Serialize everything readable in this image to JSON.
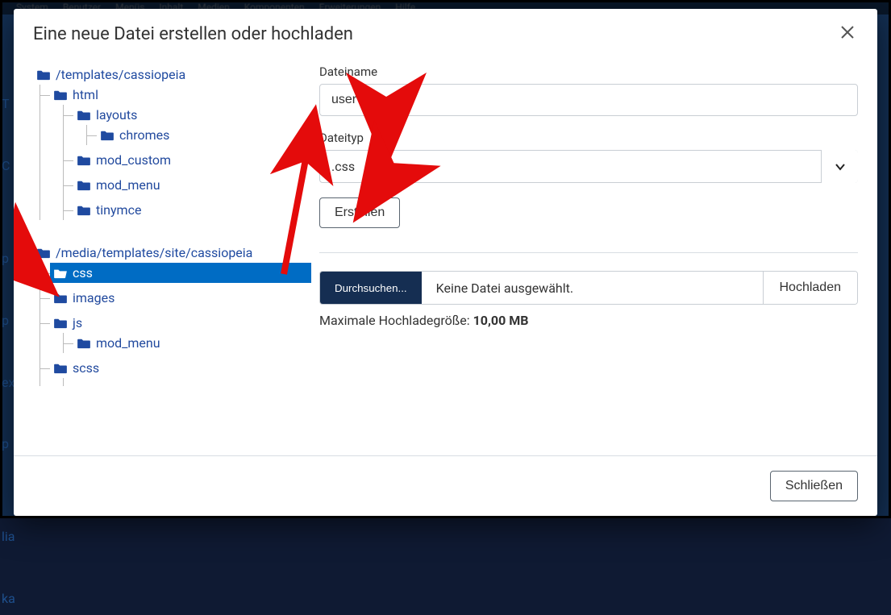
{
  "modal": {
    "title": "Eine neue Datei erstellen oder hochladen",
    "close_btn_name": "close"
  },
  "tree": {
    "root1": {
      "label": "/templates/cassiopeia",
      "children": [
        {
          "key": "html",
          "label": "html",
          "children": [
            {
              "key": "layouts",
              "label": "layouts",
              "children": [
                {
                  "key": "chromes",
                  "label": "chromes"
                }
              ]
            },
            {
              "key": "mod_custom",
              "label": "mod_custom"
            },
            {
              "key": "mod_menu",
              "label": "mod_menu"
            },
            {
              "key": "tinymce",
              "label": "tinymce"
            }
          ]
        }
      ]
    },
    "root2": {
      "label": "/media/templates/site/cassiopeia",
      "children": [
        {
          "key": "css",
          "label": "css",
          "selected": true
        },
        {
          "key": "images",
          "label": "images"
        },
        {
          "key": "js",
          "label": "js",
          "children": [
            {
              "key": "js_mod_menu",
              "label": "mod_menu"
            }
          ]
        },
        {
          "key": "scss",
          "label": "scss",
          "children": [
            {
              "key": "scss_hidden",
              "label": ""
            }
          ]
        }
      ]
    }
  },
  "form": {
    "filename_label": "Dateiname",
    "filename_value": "user",
    "filetype_label": "Dateityp",
    "filetype_value": ".css",
    "create_btn": "Erstellen",
    "browse_btn": "Durchsuchen...",
    "no_file": "Keine Datei ausgewählt.",
    "upload_btn": "Hochladen",
    "max_upload_prefix": "Maximale Hochladegröße: ",
    "max_upload_size": "10,00 MB"
  },
  "footer": {
    "close_btn": "Schließen"
  },
  "backdrop_nav": [
    "System",
    "Benutzer",
    "Menüs",
    "Inhalt",
    "Medien",
    "Komponenten",
    "Erweiterungen",
    "Hilfe"
  ]
}
